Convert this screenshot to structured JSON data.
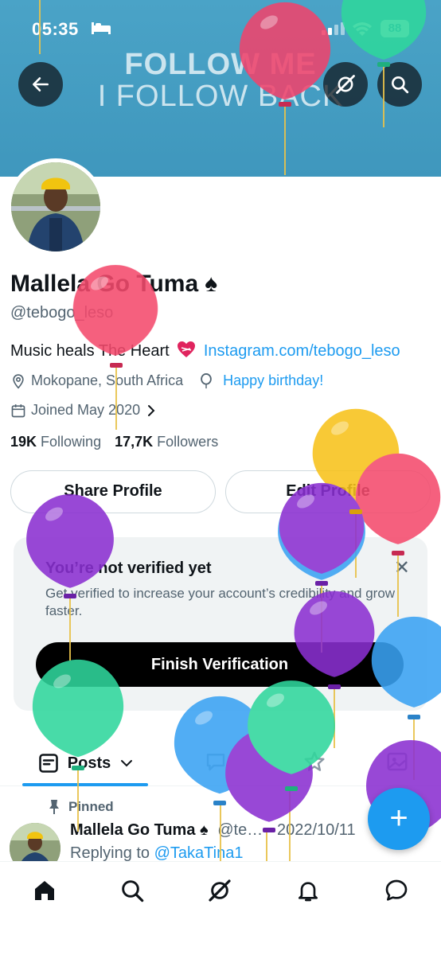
{
  "status_bar": {
    "time": "05:35",
    "battery": "88"
  },
  "banner": {
    "line1": "FOLLOW ME",
    "line2": "I FOLLOW BACK"
  },
  "profile": {
    "name": "Mallela Go Tuma",
    "name_emoji": "♠",
    "handle": "@tebogo_leso",
    "bio_text": "Music heals The Heart",
    "bio_link": "Instagram.com/tebogo_leso",
    "location": "Mokopane, South Africa",
    "birthday": "Happy birthday!",
    "joined": "Joined May 2020",
    "following_count": "19K",
    "following_label": "Following",
    "followers_count": "17,7K",
    "followers_label": "Followers"
  },
  "buttons": {
    "share": "Share Profile",
    "edit": "Edit Profile"
  },
  "verify": {
    "title": "You’re not verified yet",
    "description": "Get verified to increase your account’s credibility and grow faster.",
    "button": "Finish Verification",
    "close": "✕"
  },
  "tabs": {
    "posts": "Posts"
  },
  "post": {
    "pinned_label": "Pinned",
    "author": "Mallela Go Tuma",
    "author_emoji": "♠",
    "meta": "@te… · 2022/10/11",
    "reply_prefix": "Replying to",
    "reply_handle": "@TakaTina1"
  },
  "fab": {
    "label": "+"
  },
  "colors": {
    "accent": "#1d9bf0",
    "banner": "#4aa3c7",
    "text": "#0f1419",
    "muted": "#536471"
  },
  "icons": {
    "back": "arrow-left-icon",
    "grok": "grok-icon",
    "search": "search-icon",
    "location": "location-pin-icon",
    "balloon": "balloon-icon",
    "calendar": "calendar-icon",
    "home": "home-icon",
    "notifications": "bell-icon",
    "messages": "chat-bubble-icon"
  }
}
